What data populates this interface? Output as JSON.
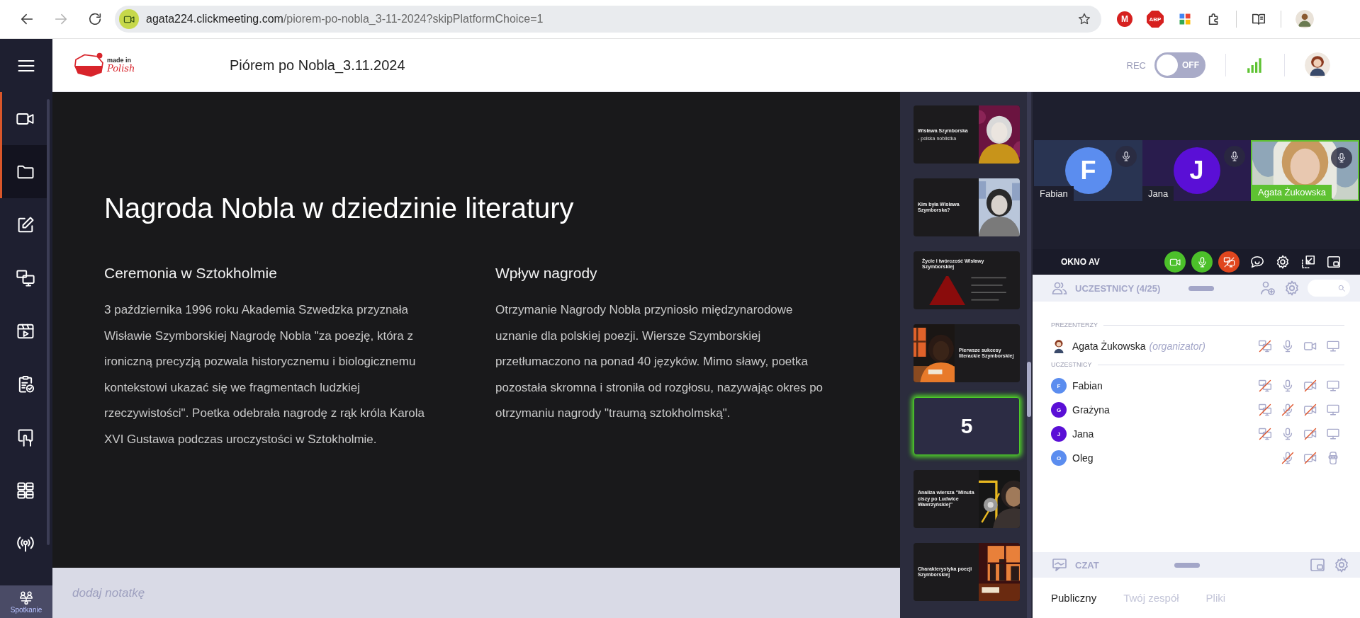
{
  "browser": {
    "url_host": "agata224.clickmeeting.com",
    "url_path": "/piorem-po-nobla_3-11-2024?skipPlatformChoice=1",
    "forward_disabled": true,
    "extensions": [
      {
        "kind": "badge",
        "label": "M"
      },
      {
        "kind": "stop",
        "label": "ABP"
      },
      {
        "kind": "blocks"
      },
      {
        "kind": "puzzle"
      }
    ]
  },
  "app_header": {
    "logo": {
      "line1": "made in",
      "line2": "Polish"
    },
    "title": "Piórem po Nobla_3.11.2024",
    "rec": {
      "label": "REC",
      "on": false,
      "state_text": "OFF"
    }
  },
  "sidebar": {
    "items": [
      {
        "kind": "video",
        "selected": false,
        "active": true
      },
      {
        "kind": "folder",
        "selected": true,
        "active": true
      },
      {
        "kind": "edit",
        "selected": false,
        "active": false
      },
      {
        "kind": "screens",
        "selected": false,
        "active": false
      },
      {
        "kind": "player",
        "selected": false,
        "active": false
      },
      {
        "kind": "clipboard",
        "selected": false,
        "active": false
      },
      {
        "kind": "touch",
        "selected": false,
        "active": false
      },
      {
        "kind": "grid",
        "selected": false,
        "active": false
      },
      {
        "kind": "broadcast",
        "selected": false,
        "active": false
      }
    ],
    "bottom": {
      "label": "Spotkanie",
      "selected": true
    }
  },
  "slide": {
    "title": "Nagroda Nobla w dziedzinie literatury",
    "columns": [
      {
        "heading": "Ceremonia w Sztokholmie",
        "text": "3 października 1996 roku Akademia Szwedzka przyznała Wisławie Szymborskiej Nagrodę Nobla \"za poezję, która z ironiczną precyzją pozwala historycznemu i biologicznemu kontekstowi ukazać się we fragmentach ludzkiej rzeczywistości\". Poetka odebrała nagrodę z rąk króla Karola XVI Gustawa podczas uroczystości w Sztokholmie."
      },
      {
        "heading": "Wpływ nagrody",
        "text": "Otrzymanie Nagrody Nobla przyniosło międzynarodowe uznanie dla polskiej poezji. Wiersze Szymborskiej przetłumaczono na ponad 40 języków. Mimo sławy, poetka pozostała skromna i stroniła od rozgłosu, nazywając okres po otrzymaniu nagrody \"traumą sztokholmską\"."
      }
    ]
  },
  "notes": {
    "placeholder": "dodaj notatkę"
  },
  "thumbnails": [
    {
      "kind": "picture-right",
      "title": "Wisława Szymborska",
      "subtitle": "- polska noblistka",
      "selected": false
    },
    {
      "kind": "picture-right",
      "title": "Kim była Wisława Szymborska?",
      "selected": false
    },
    {
      "kind": "pyramid",
      "title": "Życie i twórczość Wisławy Szymborskiej",
      "selected": false
    },
    {
      "kind": "picture-left",
      "title": "Pierwsze sukcesy literackie Szymborskiej",
      "selected": false
    },
    {
      "kind": "current",
      "number": "5",
      "selected": true
    },
    {
      "kind": "picture-right",
      "title": "Analiza wiersza \"Minuta ciszy po Ludwice Wawrzyńskiej\"",
      "selected": false
    },
    {
      "kind": "picture-right",
      "title": "Charakterystyka poezji Szymborskiej",
      "selected": false
    }
  ],
  "video_tiles": [
    {
      "kind": "avatar",
      "name": "Fabian",
      "initial": "F",
      "color": "#5b8def",
      "speaking": false,
      "mic_on": true
    },
    {
      "kind": "avatar",
      "name": "Jana",
      "initial": "J",
      "color": "#5a0fd6",
      "speaking": false,
      "mic_on": true
    },
    {
      "kind": "camera",
      "name": "Agata Żukowska",
      "speaking": true,
      "mic_on": true
    }
  ],
  "av_bar": {
    "title": "OKNO AV",
    "camera_on": true,
    "mic_on": true,
    "share_on": false
  },
  "participants_panel": {
    "title": "UCZESTNICY (4/25)",
    "groups": [
      {
        "label": "PREZENTERZY",
        "people": [
          {
            "name": "Agata Żukowska",
            "role": "(organizator)",
            "screen_share": false,
            "mic": true,
            "camera": true,
            "kind": "desktop"
          }
        ]
      },
      {
        "label": "UCZESTNICY",
        "people": [
          {
            "name": "Fabian",
            "initial": "F",
            "color": "#5b8def",
            "screen_share": false,
            "mic": true,
            "camera": false,
            "kind": "desktop"
          },
          {
            "name": "Grażyna",
            "initial": "G",
            "color": "#5a0fd6",
            "screen_share": false,
            "mic": false,
            "camera": false,
            "kind": "desktop"
          },
          {
            "name": "Jana",
            "initial": "J",
            "color": "#5a0fd6",
            "screen_share": false,
            "mic": true,
            "camera": false,
            "kind": "desktop"
          },
          {
            "name": "Oleg",
            "initial": "O",
            "color": "#5b8def",
            "mic": false,
            "camera": false,
            "kind": "mobile"
          }
        ]
      }
    ]
  },
  "chat": {
    "title": "CZAT",
    "tabs": [
      {
        "label": "Publiczny",
        "selected": true
      },
      {
        "label": "Twój zespół",
        "selected": false
      },
      {
        "label": "Pliki",
        "selected": false
      }
    ]
  }
}
